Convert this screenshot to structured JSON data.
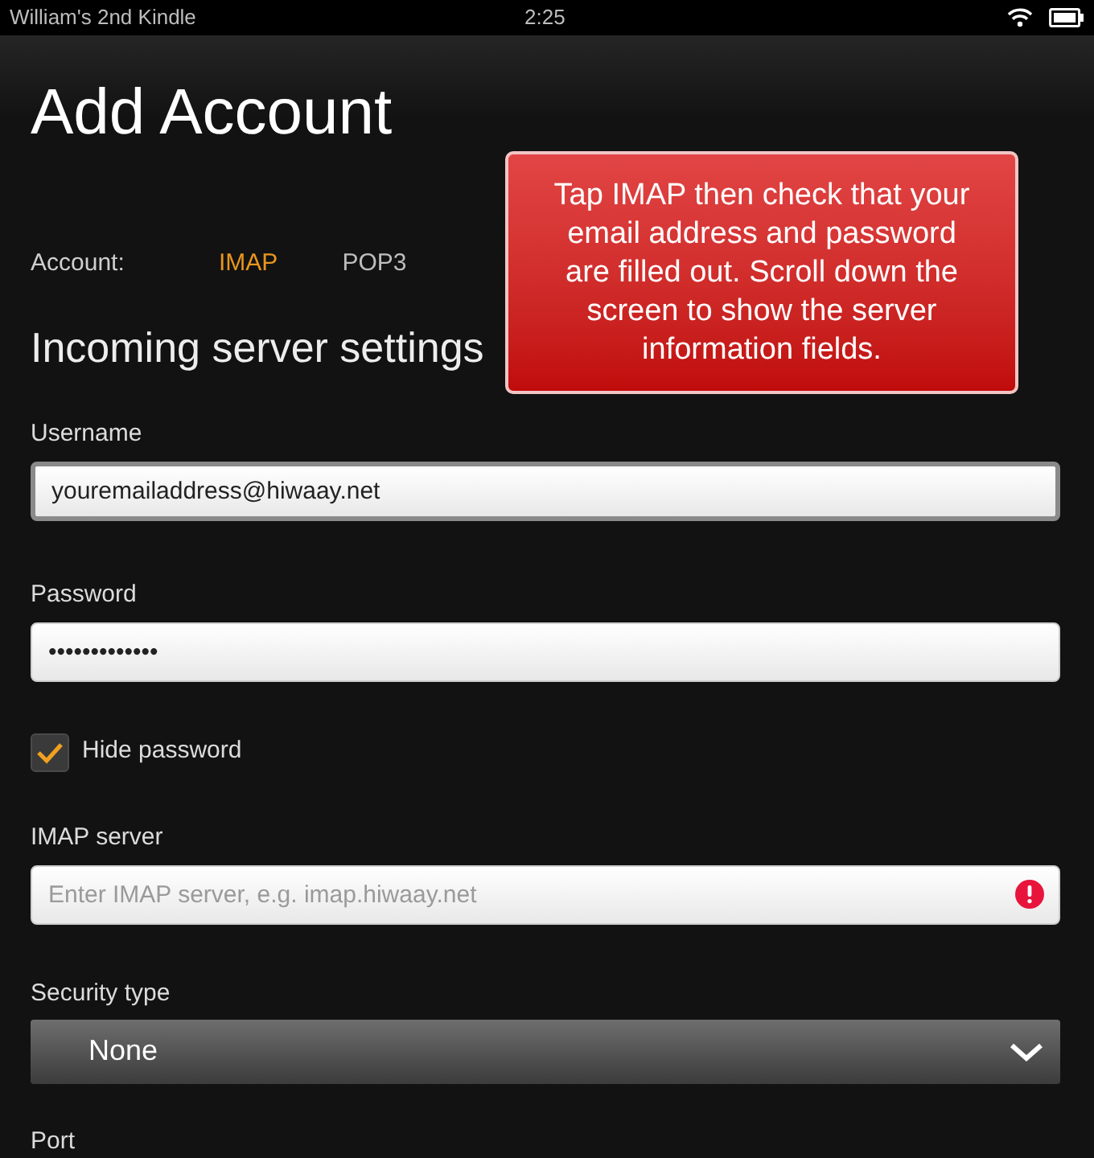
{
  "status_bar": {
    "device_name": "William's 2nd Kindle",
    "time": "2:25"
  },
  "title": "Add Account",
  "account": {
    "label": "Account:",
    "tabs": [
      {
        "label": "IMAP",
        "selected": true
      },
      {
        "label": "POP3",
        "selected": false
      }
    ]
  },
  "callout": "Tap IMAP then check that your email address and password are filled out. Scroll down the screen to show the server information fields.",
  "section_title": "Incoming server settings",
  "fields": [
    {
      "kind": "text",
      "label": "Username",
      "value": "youremailaddress@hiwaay.net",
      "focused": true
    },
    {
      "kind": "text",
      "label": "Password",
      "value": "•••••••••••••",
      "focused": false
    },
    {
      "kind": "checkbox",
      "label": "Hide password",
      "checked": true
    },
    {
      "kind": "text",
      "label": "IMAP server",
      "placeholder": "Enter IMAP server, e.g. imap.hiwaay.net",
      "error": true,
      "focused": false
    },
    {
      "kind": "select",
      "label": "Security type",
      "value": "None"
    },
    {
      "kind": "label",
      "label": "Port"
    }
  ]
}
